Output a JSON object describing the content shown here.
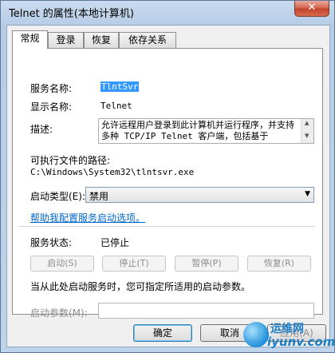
{
  "window": {
    "title": "Telnet 的属性(本地计算机)",
    "close_glyph": "✕"
  },
  "tabs": [
    "常规",
    "登录",
    "恢复",
    "依存关系"
  ],
  "general": {
    "service_name_label": "服务名称:",
    "service_name_value": "TlntSvr",
    "display_name_label": "显示名称:",
    "display_name_value": "Telnet",
    "description_label": "描述:",
    "description_value": "允许远程用户登录到此计算机并运行程序，并支持多种 TCP/IP Telnet 客户端，包括基于",
    "exe_path_label": "可执行文件的路径:",
    "exe_path_value": "C:\\Windows\\System32\\tlntsvr.exe",
    "startup_type_label": "启动类型(E):",
    "startup_type_value": "禁用",
    "help_link": "帮助我配置服务启动选项。",
    "service_status_label": "服务状态:",
    "service_status_value": "已停止",
    "buttons": {
      "start": "启动(S)",
      "stop": "停止(T)",
      "pause": "暂停(P)",
      "resume": "恢复(R)"
    },
    "hint": "当从此处启动服务时，您可指定所适用的启动参数。",
    "start_params_label": "启动参数(M):",
    "start_params_value": ""
  },
  "dialog_buttons": {
    "ok": "确定",
    "cancel": "取消",
    "apply": "应用(A)"
  },
  "watermark": {
    "line1": "运维网",
    "line2": "iyunv.com"
  }
}
